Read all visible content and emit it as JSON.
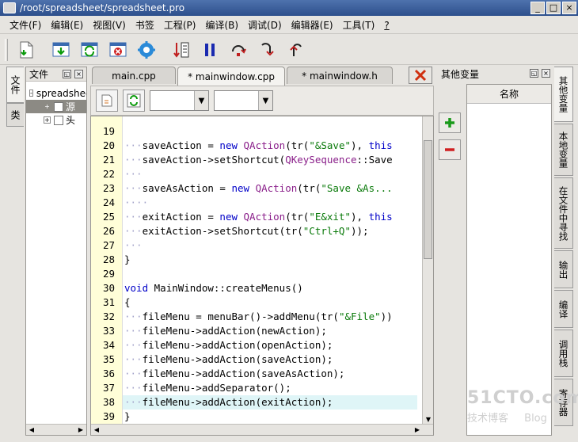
{
  "window": {
    "title": "/root/spreadsheet/spreadsheet.pro",
    "buttons": [
      "_",
      "□",
      "×"
    ]
  },
  "menu": [
    "文件(F)",
    "编辑(E)",
    "视图(V)",
    "书签",
    "工程(P)",
    "编译(B)",
    "调试(D)",
    "编辑器(E)",
    "工具(T)",
    "?"
  ],
  "toolbar": {
    "icons": [
      "new-file-icon",
      "open-download-icon",
      "refresh-green-icon",
      "stop-red-icon",
      "settings-gear-icon",
      "sort-list-icon",
      "pause-icon",
      "step-over-icon",
      "step-into-icon",
      "step-out-icon"
    ]
  },
  "left_tabs": [
    "文件",
    "类"
  ],
  "file_panel": {
    "title": "文件",
    "items": [
      {
        "label": "spreadsheet",
        "expander": "-"
      },
      {
        "label": "源",
        "expander": "+",
        "selected": true
      },
      {
        "label": "头",
        "expander": "+"
      }
    ]
  },
  "editor": {
    "tabs": [
      {
        "label": "main.cpp",
        "active": false
      },
      {
        "label": "* mainwindow.cpp",
        "active": true
      },
      {
        "label": "* mainwindow.h",
        "active": false
      }
    ],
    "lines": [
      {
        "n": "19",
        "dots": "",
        "code": []
      },
      {
        "n": "20",
        "dots": "···",
        "code": [
          [
            "t",
            "saveAction = "
          ],
          [
            "kw",
            "new "
          ],
          [
            "cls",
            "QAction"
          ],
          [
            "t",
            "(tr("
          ],
          [
            "str",
            "\"&Save\""
          ],
          [
            "t",
            "), "
          ],
          [
            "kw",
            "this"
          ]
        ]
      },
      {
        "n": "21",
        "dots": "···",
        "code": [
          [
            "t",
            "saveAction->setShortcut("
          ],
          [
            "cls",
            "QKeySequence"
          ],
          [
            "t",
            "::Save"
          ]
        ]
      },
      {
        "n": "22",
        "dots": "···",
        "code": []
      },
      {
        "n": "23",
        "dots": "···",
        "code": [
          [
            "t",
            "saveAsAction = "
          ],
          [
            "kw",
            "new "
          ],
          [
            "cls",
            "QAction"
          ],
          [
            "t",
            "(tr("
          ],
          [
            "str",
            "\"Save &As..."
          ]
        ]
      },
      {
        "n": "24",
        "dots": "····",
        "code": []
      },
      {
        "n": "25",
        "dots": "···",
        "code": [
          [
            "t",
            "exitAction = "
          ],
          [
            "kw",
            "new "
          ],
          [
            "cls",
            "QAction"
          ],
          [
            "t",
            "(tr("
          ],
          [
            "str",
            "\"E&xit\""
          ],
          [
            "t",
            "), "
          ],
          [
            "kw",
            "this"
          ]
        ]
      },
      {
        "n": "26",
        "dots": "···",
        "code": [
          [
            "t",
            "exitAction->setShortcut(tr("
          ],
          [
            "str",
            "\"Ctrl+Q\""
          ],
          [
            "t",
            "));"
          ]
        ]
      },
      {
        "n": "27",
        "dots": "···",
        "code": []
      },
      {
        "n": "28",
        "dots": "",
        "code": [
          [
            "t",
            "}"
          ]
        ]
      },
      {
        "n": "29",
        "dots": "",
        "code": []
      },
      {
        "n": "30",
        "dots": "",
        "code": [
          [
            "kw",
            "void "
          ],
          [
            "t",
            "MainWindow::createMenus()"
          ]
        ]
      },
      {
        "n": "31",
        "dots": "",
        "code": [
          [
            "t",
            "{"
          ]
        ]
      },
      {
        "n": "32",
        "dots": "···",
        "code": [
          [
            "t",
            "fileMenu = menuBar()->addMenu(tr("
          ],
          [
            "str",
            "\"&File\""
          ],
          [
            "t",
            "))"
          ]
        ]
      },
      {
        "n": "33",
        "dots": "···",
        "code": [
          [
            "t",
            "fileMenu->addAction(newAction);"
          ]
        ]
      },
      {
        "n": "34",
        "dots": "···",
        "code": [
          [
            "t",
            "fileMenu->addAction(openAction);"
          ]
        ]
      },
      {
        "n": "35",
        "dots": "···",
        "code": [
          [
            "t",
            "fileMenu->addAction(saveAction);"
          ]
        ]
      },
      {
        "n": "36",
        "dots": "···",
        "code": [
          [
            "t",
            "fileMenu->addAction(saveAsAction);"
          ]
        ]
      },
      {
        "n": "37",
        "dots": "···",
        "code": [
          [
            "t",
            "fileMenu->addSeparator();"
          ]
        ]
      },
      {
        "n": "38",
        "dots": "···",
        "code": [
          [
            "t",
            "fileMenu->addAction(exitAction);"
          ]
        ],
        "highlight": true
      },
      {
        "n": "39",
        "dots": "",
        "code": [
          [
            "t",
            "}"
          ]
        ]
      }
    ]
  },
  "var_panel": {
    "title": "其他变量",
    "column": "名称"
  },
  "right_tabs": [
    "其他变量",
    "本地变量",
    "在文件中寻找",
    "输出",
    "编译",
    "调用栈",
    "寄存器"
  ],
  "watermark": {
    "brand": "51CTO.com",
    "tagline": "技术博客",
    "blog": "Blog"
  },
  "colors": {
    "keyword": "#0000c8",
    "class": "#8a1f8a",
    "string": "#0a7a0a",
    "gutter": "#fffed8",
    "highlight_line": "#dff5f7"
  }
}
